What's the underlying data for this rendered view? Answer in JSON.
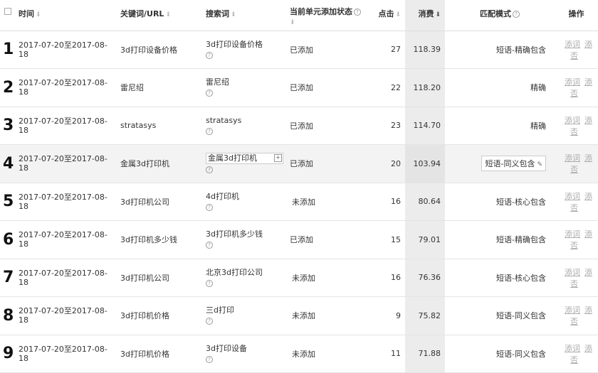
{
  "header": {
    "time": "时间",
    "keyword": "关键词/URL",
    "search": "搜索词",
    "status": "当前单元添加状态",
    "clicks": "点击",
    "cost": "消费",
    "match": "匹配模式",
    "ops": "操作"
  },
  "ops": {
    "add_word": "添词",
    "add_negative": "添否"
  },
  "rows": [
    {
      "num": "1",
      "time": "2017-07-20至2017-08-18",
      "keyword": "3d打印设备价格",
      "search": "3d打印设备价格",
      "status": "已添加",
      "clicks": "27",
      "cost": "118.39",
      "match": "短语-精确包含"
    },
    {
      "num": "2",
      "time": "2017-07-20至2017-08-18",
      "keyword": "雷尼绍",
      "search": "雷尼绍",
      "status": "已添加",
      "clicks": "22",
      "cost": "118.20",
      "match": "精确"
    },
    {
      "num": "3",
      "time": "2017-07-20至2017-08-18",
      "keyword": "stratasys",
      "search": "stratasys",
      "status": "已添加",
      "clicks": "23",
      "cost": "114.70",
      "match": "精确"
    },
    {
      "num": "4",
      "time": "2017-07-20至2017-08-18",
      "keyword": "金属3d打印机",
      "search": "金属3d打印机",
      "status": "已添加",
      "clicks": "20",
      "cost": "103.94",
      "match": "短语-同义包含"
    },
    {
      "num": "5",
      "time": "2017-07-20至2017-08-18",
      "keyword": "3d打印机公司",
      "search": "4d打印机",
      "status": "未添加",
      "clicks": "16",
      "cost": "80.64",
      "match": "短语-核心包含"
    },
    {
      "num": "6",
      "time": "2017-07-20至2017-08-18",
      "keyword": "3d打印机多少钱",
      "search": "3d打印机多少钱",
      "status": "已添加",
      "clicks": "15",
      "cost": "79.01",
      "match": "短语-精确包含"
    },
    {
      "num": "7",
      "time": "2017-07-20至2017-08-18",
      "keyword": "3d打印机公司",
      "search": "北京3d打印公司",
      "status": "未添加",
      "clicks": "16",
      "cost": "76.36",
      "match": "短语-核心包含"
    },
    {
      "num": "8",
      "time": "2017-07-20至2017-08-18",
      "keyword": "3d打印机价格",
      "search": "三d打印",
      "status": "未添加",
      "clicks": "9",
      "cost": "75.82",
      "match": "短语-同义包含"
    },
    {
      "num": "9",
      "time": "2017-07-20至2017-08-18",
      "keyword": "3d打印机价格",
      "search": "3d打印设备",
      "status": "未添加",
      "clicks": "11",
      "cost": "71.88",
      "match": "短语-同义包含"
    }
  ]
}
